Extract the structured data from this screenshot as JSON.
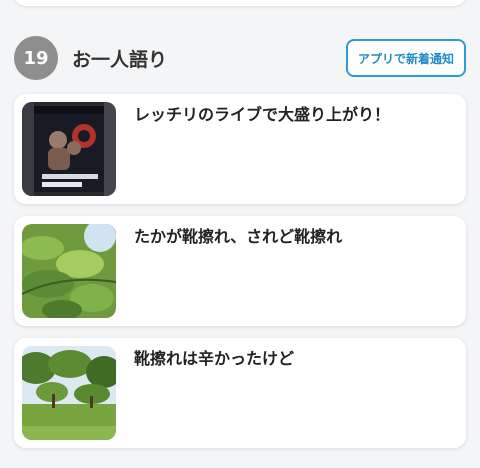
{
  "section": {
    "rank": "19",
    "title": "お一人語り",
    "app_button_label": "アプリで新着通知"
  },
  "articles": [
    {
      "title": "レッチリのライブで大盛り上がり！",
      "thumbnail": "concert-poster-image"
    },
    {
      "title": "たかが靴擦れ、されど靴擦れ",
      "thumbnail": "green-leaves-image"
    },
    {
      "title": "靴擦れは辛かったけど",
      "thumbnail": "park-trees-image"
    }
  ]
}
